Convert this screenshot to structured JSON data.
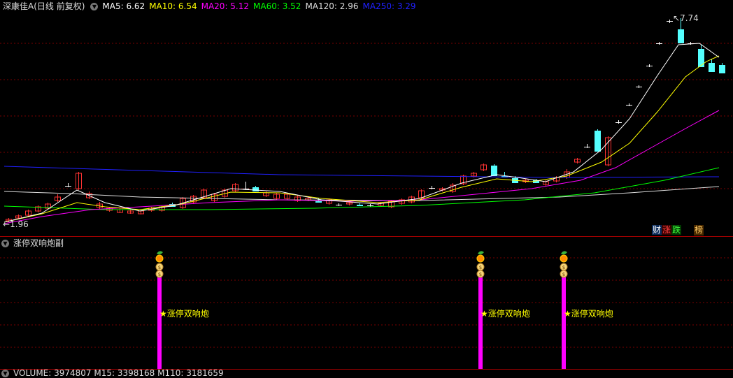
{
  "main": {
    "stock_title": "深康佳A",
    "period_label": "(日线 前复权)",
    "ma": [
      {
        "label": "MA5: 6.62",
        "color": "#ffffff"
      },
      {
        "label": "MA10: 6.54",
        "color": "#ffff00"
      },
      {
        "label": "MA20: 5.12",
        "color": "#ff00ff"
      },
      {
        "label": "MA60: 3.52",
        "color": "#00ff00"
      },
      {
        "label": "MA120: 2.96",
        "color": "#dddddd"
      },
      {
        "label": "MA250: 3.29",
        "color": "#0000ff"
      }
    ],
    "high_mark": "7.74",
    "low_mark": "1.96",
    "tags": {
      "fin": "财",
      "rise": "涨",
      "fall": "跌",
      "rank": "榜"
    }
  },
  "sub": {
    "indicator_name": "涨停双响炮副",
    "signal_label": "★涨停双响炮"
  },
  "volume": {
    "label": "VOLUME: 3974807  M15: 3398168  M110: 3181659"
  },
  "colors": {
    "up": "#ff3232",
    "down": "#54ffff",
    "grid": "#7a0000",
    "signal_bar": "#ff00ff"
  },
  "chart_data": {
    "type": "candlestick",
    "high": 7.74,
    "low": 1.96,
    "signal_count": 3
  }
}
